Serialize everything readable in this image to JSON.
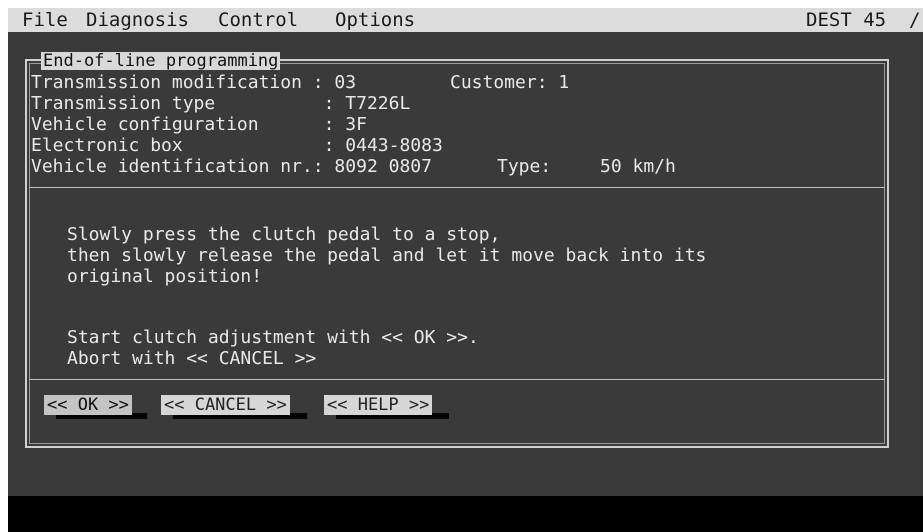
{
  "menubar": {
    "items": [
      "File",
      "Diagnosis",
      "Control",
      "Options"
    ],
    "right_text": "DEST 45  /"
  },
  "dialog": {
    "title": "End-of-line programming",
    "info": {
      "transmission_modification_label": "Transmission modification : 03",
      "customer": "Customer: 1",
      "transmission_type": "Transmission type          : T7226L",
      "vehicle_configuration": "Vehicle configuration      : 3F",
      "electronic_box": "Electronic box             : 0443-8083",
      "vehicle_identification": "Vehicle identification nr.: 8092 0807",
      "type_label": "Type:",
      "type_value": "50 km/h"
    },
    "instructions": [
      "Slowly press the clutch pedal to a stop,",
      "then slowly release the pedal and let it move back into its",
      "original position!"
    ],
    "prompts": [
      "Start clutch adjustment with << OK >>.",
      "Abort with << CANCEL >>"
    ],
    "buttons": {
      "ok": "<< OK >>",
      "cancel": "<< CANCEL >>",
      "help": "<< HELP >>"
    }
  }
}
